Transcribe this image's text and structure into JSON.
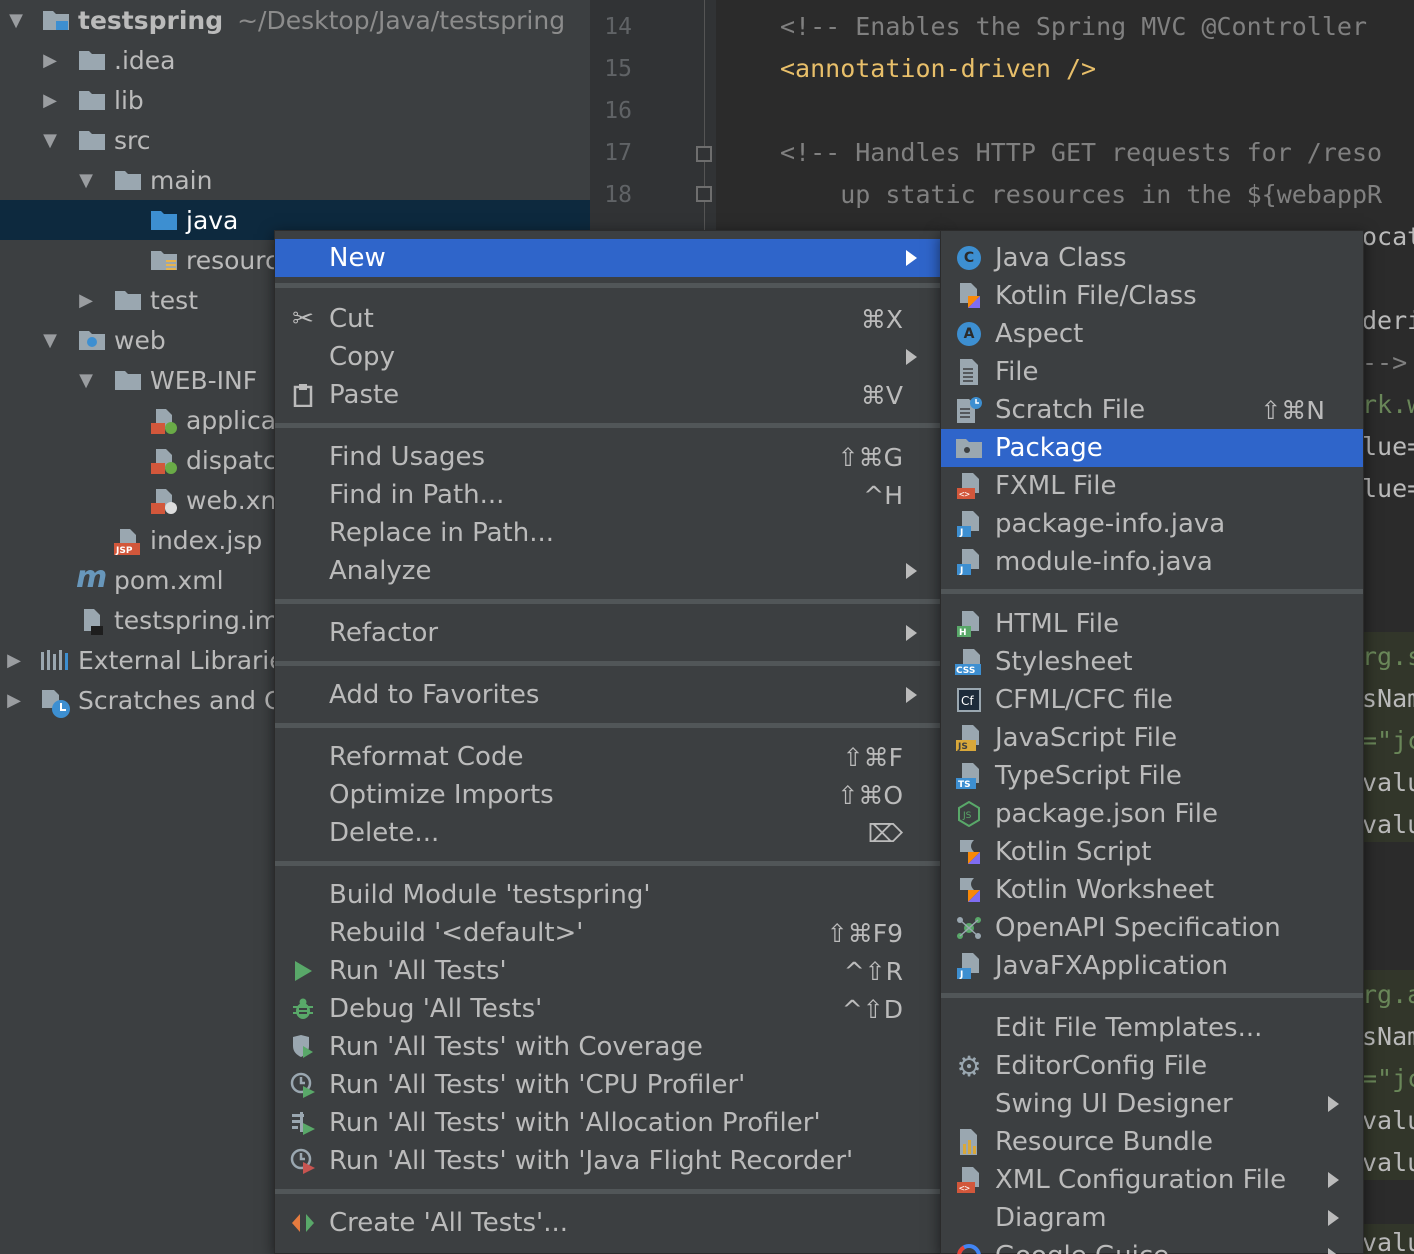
{
  "project_tree": {
    "root": {
      "name": "testspring",
      "path": "~/Desktop/Java/testspring"
    },
    "items": [
      {
        "label": ".idea"
      },
      {
        "label": "lib"
      },
      {
        "label": "src"
      },
      {
        "label": "main"
      },
      {
        "label": "java"
      },
      {
        "label": "resourc"
      },
      {
        "label": "test"
      },
      {
        "label": "web"
      },
      {
        "label": "WEB-INF"
      },
      {
        "label": "applica"
      },
      {
        "label": "dispatc"
      },
      {
        "label": "web.xn"
      },
      {
        "label": "index.jsp"
      },
      {
        "label": "pom.xml"
      },
      {
        "label": "testspring.im"
      },
      {
        "label": "External Librarie"
      },
      {
        "label": "Scratches and C"
      }
    ]
  },
  "editor": {
    "line_numbers": [
      "14",
      "15",
      "16",
      "17",
      "18"
    ],
    "lines": [
      "<!-- Enables the Spring MVC @Controller",
      "<annotation-driven />",
      "",
      "<!-- Handles HTTP GET requests for /reso",
      "    up static resources in the ${webappR"
    ],
    "right_fragments": [
      "ocat",
      "deri",
      "-->",
      "rk.w",
      "lue=",
      "lue=",
      "rg.s",
      "sNam",
      "=\"jc",
      "valu",
      "valu",
      "rg.a",
      "sNam",
      "=\"jc",
      "valu",
      "valu",
      "valu"
    ]
  },
  "context_menu": {
    "items": [
      {
        "label": "New",
        "shortcut": "",
        "submenu": true
      },
      {
        "label": "Cut",
        "shortcut": "⌘X"
      },
      {
        "label": "Copy",
        "shortcut": "",
        "submenu": true
      },
      {
        "label": "Paste",
        "shortcut": "⌘V"
      },
      {
        "label": "Find Usages",
        "shortcut": "⇧⌘G"
      },
      {
        "label": "Find in Path...",
        "shortcut": "^H"
      },
      {
        "label": "Replace in Path...",
        "shortcut": ""
      },
      {
        "label": "Analyze",
        "shortcut": "",
        "submenu": true
      },
      {
        "label": "Refactor",
        "shortcut": "",
        "submenu": true
      },
      {
        "label": "Add to Favorites",
        "shortcut": "",
        "submenu": true
      },
      {
        "label": "Reformat Code",
        "shortcut": "⇧⌘F"
      },
      {
        "label": "Optimize Imports",
        "shortcut": "⇧⌘O"
      },
      {
        "label": "Delete...",
        "shortcut": "⌦"
      },
      {
        "label": "Build Module 'testspring'",
        "shortcut": ""
      },
      {
        "label": "Rebuild '<default>'",
        "shortcut": "⇧⌘F9"
      },
      {
        "label": "Run 'All Tests'",
        "shortcut": "^⇧R"
      },
      {
        "label": "Debug 'All Tests'",
        "shortcut": "^⇧D"
      },
      {
        "label": "Run 'All Tests' with Coverage",
        "shortcut": ""
      },
      {
        "label": "Run 'All Tests' with 'CPU Profiler'",
        "shortcut": ""
      },
      {
        "label": "Run 'All Tests' with 'Allocation Profiler'",
        "shortcut": ""
      },
      {
        "label": "Run 'All Tests' with 'Java Flight Recorder'",
        "shortcut": ""
      },
      {
        "label": "Create 'All Tests'...",
        "shortcut": ""
      }
    ]
  },
  "new_submenu": {
    "items": [
      {
        "label": "Java Class",
        "shortcut": ""
      },
      {
        "label": "Kotlin File/Class",
        "shortcut": ""
      },
      {
        "label": "Aspect",
        "shortcut": ""
      },
      {
        "label": "File",
        "shortcut": ""
      },
      {
        "label": "Scratch File",
        "shortcut": "⇧⌘N"
      },
      {
        "label": "Package",
        "shortcut": ""
      },
      {
        "label": "FXML File",
        "shortcut": ""
      },
      {
        "label": "package-info.java",
        "shortcut": ""
      },
      {
        "label": "module-info.java",
        "shortcut": ""
      },
      {
        "label": "HTML File",
        "shortcut": ""
      },
      {
        "label": "Stylesheet",
        "shortcut": ""
      },
      {
        "label": "CFML/CFC file",
        "shortcut": ""
      },
      {
        "label": "JavaScript File",
        "shortcut": ""
      },
      {
        "label": "TypeScript File",
        "shortcut": ""
      },
      {
        "label": "package.json File",
        "shortcut": ""
      },
      {
        "label": "Kotlin Script",
        "shortcut": ""
      },
      {
        "label": "Kotlin Worksheet",
        "shortcut": ""
      },
      {
        "label": "OpenAPI Specification",
        "shortcut": ""
      },
      {
        "label": "JavaFXApplication",
        "shortcut": ""
      },
      {
        "label": "Edit File Templates...",
        "shortcut": ""
      },
      {
        "label": "EditorConfig File",
        "shortcut": ""
      },
      {
        "label": "Swing UI Designer",
        "shortcut": "",
        "submenu": true
      },
      {
        "label": "Resource Bundle",
        "shortcut": ""
      },
      {
        "label": "XML Configuration File",
        "shortcut": "",
        "submenu": true
      },
      {
        "label": "Diagram",
        "shortcut": "",
        "submenu": true
      },
      {
        "label": "Google Guice",
        "shortcut": "",
        "submenu": true
      }
    ]
  },
  "colors": {
    "selection": "#2f65ca",
    "tree_selection": "#0d293e",
    "folder": "#9aa7b0",
    "source_folder": "#3d8fd1",
    "comment": "#808080",
    "tag": "#e8bf6a"
  }
}
